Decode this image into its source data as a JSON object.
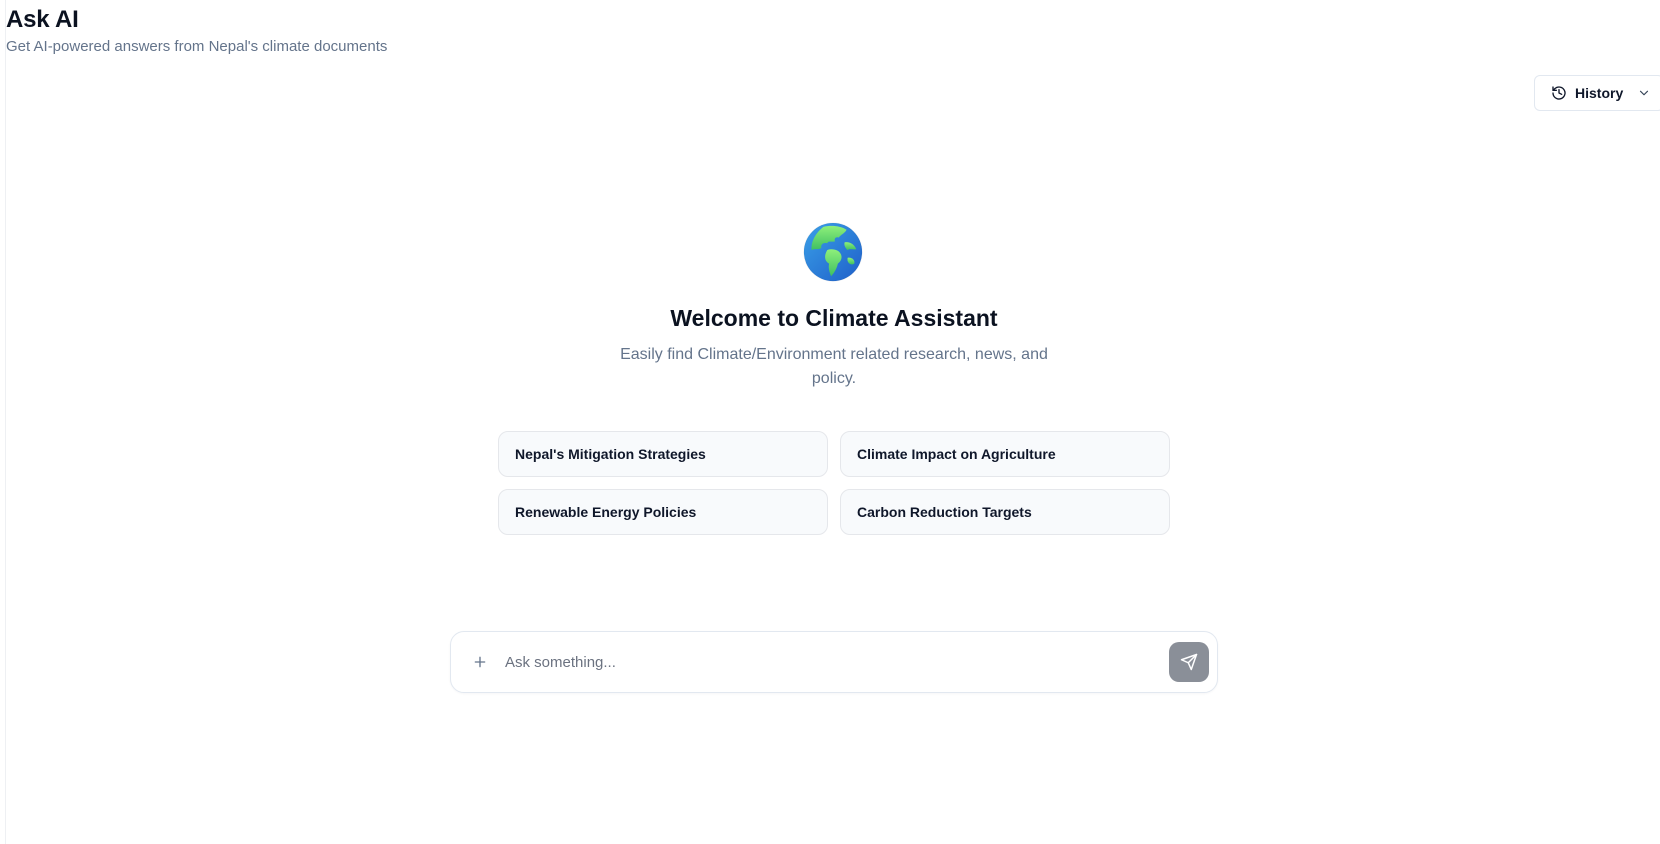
{
  "header": {
    "title": "Ask AI",
    "subtitle": "Get AI-powered answers from Nepal's climate documents"
  },
  "history": {
    "label": "History",
    "icon": "history-icon",
    "chevron_icon": "chevron-down-icon"
  },
  "welcome": {
    "icon": "globe-icon",
    "title": "Welcome to Climate Assistant",
    "description": "Easily find Climate/Environment related research, news, and policy."
  },
  "suggestions": [
    {
      "label": "Nepal's Mitigation Strategies"
    },
    {
      "label": "Climate Impact on Agriculture"
    },
    {
      "label": "Renewable Energy Policies"
    },
    {
      "label": "Carbon Reduction Targets"
    }
  ],
  "composer": {
    "placeholder": "Ask something...",
    "value": "",
    "attach_icon": "plus-icon",
    "send_icon": "send-icon"
  },
  "colors": {
    "send_button": "#8a8f98",
    "chip_background": "#f8fafc",
    "muted_text": "#64748b"
  }
}
